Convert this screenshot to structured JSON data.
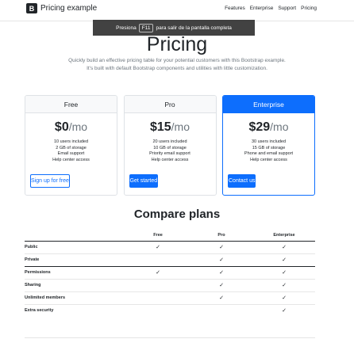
{
  "header": {
    "brand_logo": "B",
    "brand": "Pricing example",
    "nav": [
      "Features",
      "Enterprise",
      "Support",
      "Pricing"
    ]
  },
  "fullscreen_notice": {
    "prefix": "Presiona",
    "key": "F11",
    "suffix": "para salir de la pantalla completa"
  },
  "hero": {
    "title": "Pricing",
    "lead": "Quickly build an effective pricing table for your potential customers with this Bootstrap example. It's built with default Bootstrap components and utilities with little customization."
  },
  "plans": [
    {
      "name": "Free",
      "price": "$0",
      "period": "/mo",
      "features": [
        "10 users included",
        "2 GB of storage",
        "Email support",
        "Help center access"
      ],
      "button": "Sign up for free"
    },
    {
      "name": "Pro",
      "price": "$15",
      "period": "/mo",
      "features": [
        "20 users included",
        "10 GB of storage",
        "Priority email support",
        "Help center access"
      ],
      "button": "Get started"
    },
    {
      "name": "Enterprise",
      "price": "$29",
      "period": "/mo",
      "features": [
        "30 users included",
        "15 GB of storage",
        "Phone and email support",
        "Help center access"
      ],
      "button": "Contact us"
    }
  ],
  "compare": {
    "title": "Compare plans",
    "columns": [
      "",
      "Free",
      "Pro",
      "Enterprise"
    ],
    "check_glyph": "✓",
    "rows": [
      {
        "label": "Public",
        "free": true,
        "pro": true,
        "enterprise": true
      },
      {
        "label": "Private",
        "free": false,
        "pro": true,
        "enterprise": true
      },
      {
        "label": "Permissions",
        "free": true,
        "pro": true,
        "enterprise": true
      },
      {
        "label": "Sharing",
        "free": false,
        "pro": true,
        "enterprise": true
      },
      {
        "label": "Unlimited members",
        "free": false,
        "pro": true,
        "enterprise": true
      },
      {
        "label": "Extra security",
        "free": false,
        "pro": false,
        "enterprise": true
      }
    ]
  },
  "colors": {
    "primary": "#0d6efd",
    "muted": "#6c757d",
    "text": "#212529"
  }
}
